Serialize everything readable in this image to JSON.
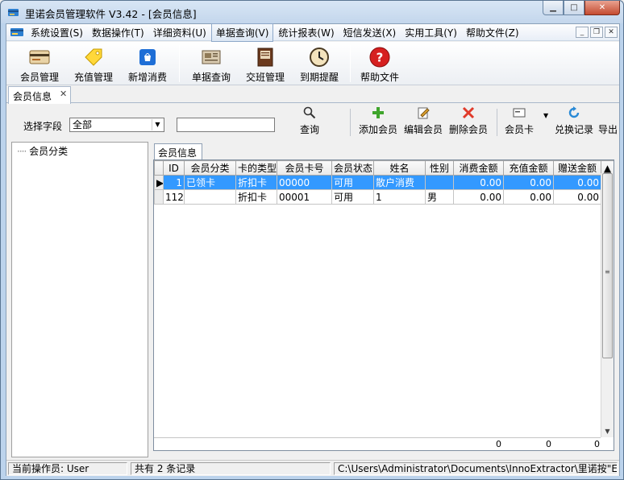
{
  "window": {
    "title": "里诺会员管理软件 V3.42 - [会员信息]",
    "colors": {
      "selection": "#3399ff",
      "close": "#c44b30"
    }
  },
  "menubar": {
    "items": [
      "系统设置(S)",
      "数据操作(T)",
      "详细资料(U)",
      "单据查询(V)",
      "统计报表(W)",
      "短信发送(X)",
      "实用工具(Y)",
      "帮助文件(Z)"
    ],
    "active_index": 3
  },
  "toolbar": {
    "buttons": [
      {
        "label": "会员管理",
        "icon": "member-card-icon"
      },
      {
        "label": "充值管理",
        "icon": "recharge-tag-icon"
      },
      {
        "label": "新增消费",
        "icon": "shopping-bag-icon"
      },
      {
        "label": "单据查询",
        "icon": "receipt-icon"
      },
      {
        "label": "交班管理",
        "icon": "handover-book-icon"
      },
      {
        "label": "到期提醒",
        "icon": "alarm-clock-icon"
      },
      {
        "label": "帮助文件",
        "icon": "help-icon"
      }
    ]
  },
  "doc_tab": {
    "label": "会员信息"
  },
  "query": {
    "field_label": "选择字段",
    "field_value": "全部",
    "search_value": "",
    "buttons": {
      "search": "查询",
      "add": "添加会员",
      "edit": "编辑会员",
      "delete": "删除会员",
      "card": "会员卡",
      "redeem": "兑换记录",
      "export": "导出"
    }
  },
  "tree": {
    "root": "会员分类"
  },
  "inner_tab": {
    "label": "会员信息"
  },
  "table": {
    "columns": [
      "ID",
      "会员分类",
      "卡的类型",
      "会员卡号",
      "会员状态",
      "姓名",
      "性别",
      "消费金额",
      "充值金额",
      "赠送金额"
    ],
    "rows": [
      {
        "id": "1",
        "category": "已领卡",
        "card_type": "折扣卡",
        "card_no": "00000",
        "status": "可用",
        "name": "散户消费",
        "gender": "",
        "consume": "0.00",
        "recharge": "0.00",
        "gift": "0.00",
        "selected": true
      },
      {
        "id": "112",
        "category": "",
        "card_type": "折扣卡",
        "card_no": "00001",
        "status": "可用",
        "name": "1",
        "gender": "男",
        "consume": "0.00",
        "recharge": "0.00",
        "gift": "0.00",
        "selected": false
      }
    ],
    "footer": {
      "consume_total": "0",
      "recharge_total": "0",
      "gift_total": "0"
    }
  },
  "statusbar": {
    "operator": "当前操作员: User",
    "count": "共有 2 条记录",
    "path": "C:\\Users\\Administrator\\Documents\\InnoExtractor\\里诺按\"Enc"
  }
}
